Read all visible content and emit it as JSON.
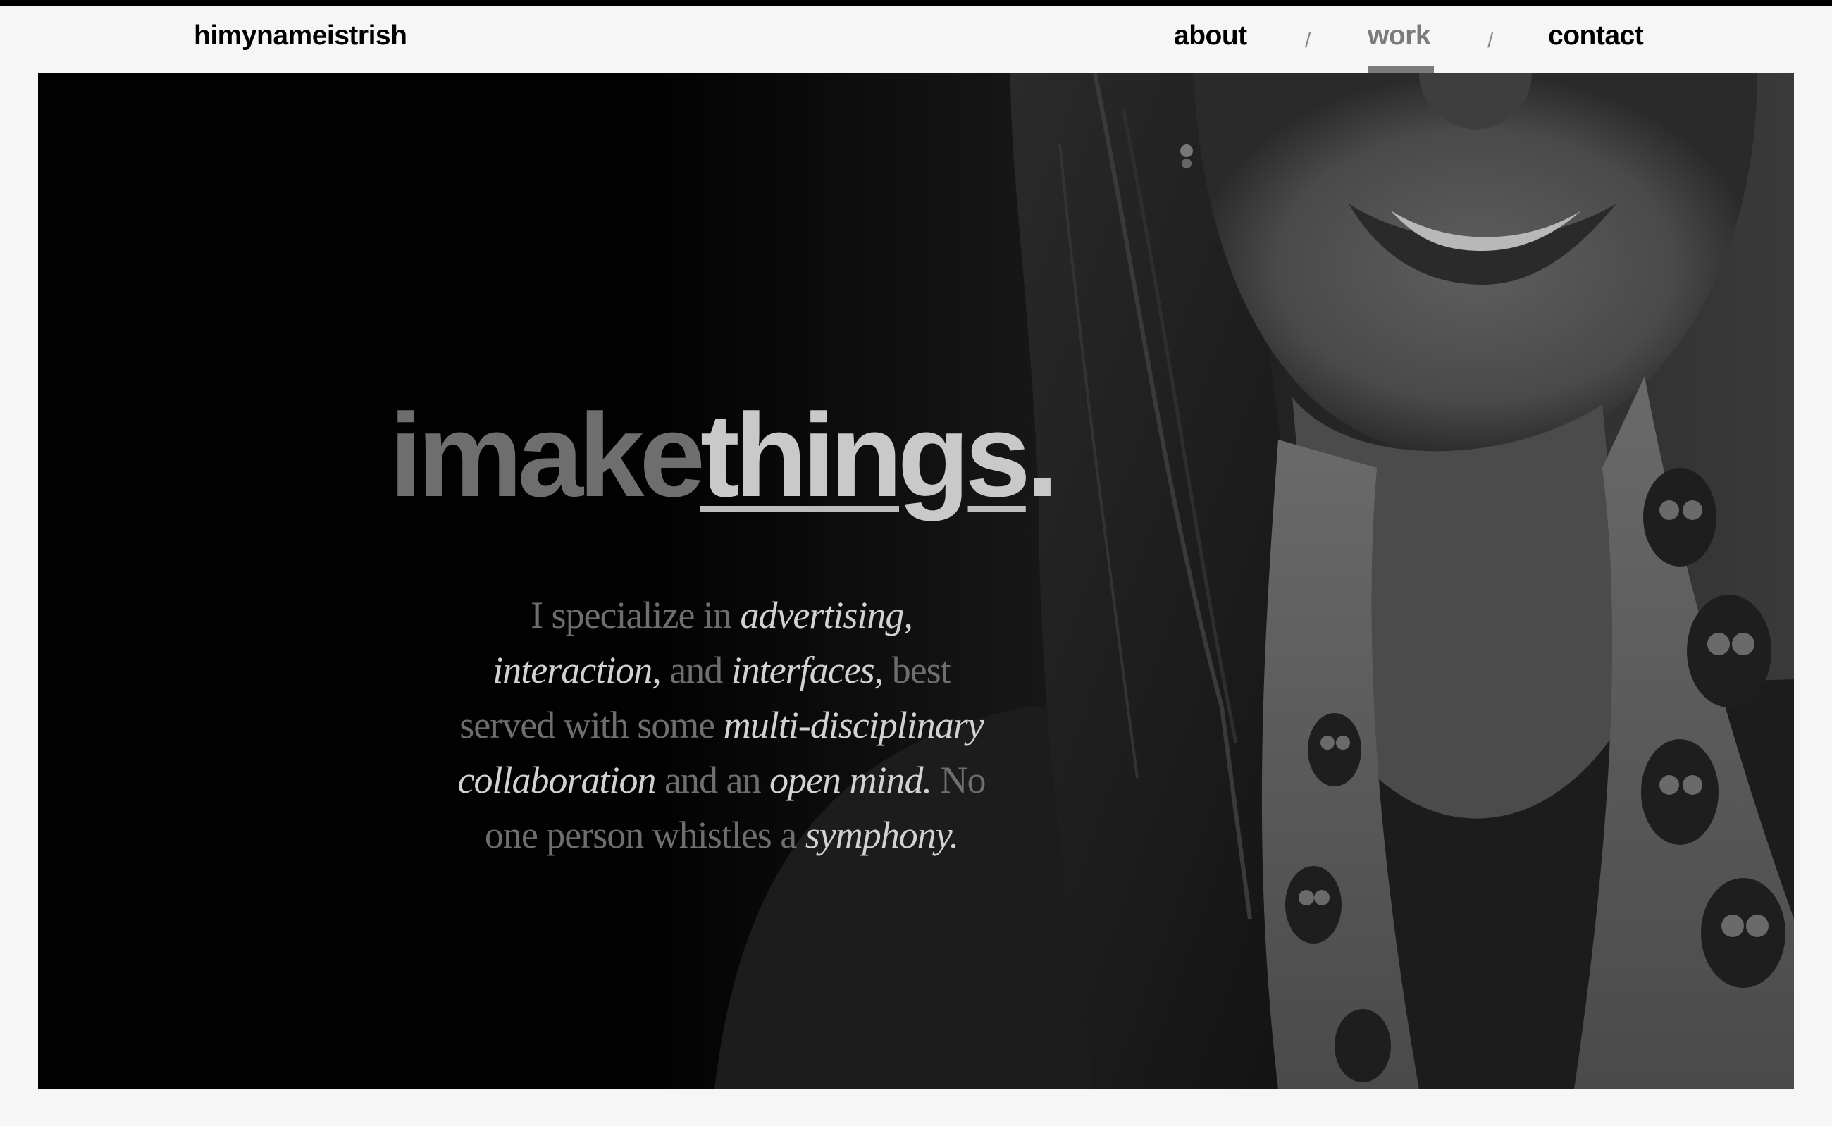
{
  "header": {
    "brand": "himynameistrish",
    "nav": [
      {
        "label": "about",
        "active": false
      },
      {
        "label": "work",
        "active": true
      },
      {
        "label": "contact",
        "active": false
      }
    ],
    "separator": "/"
  },
  "hero": {
    "headline_prefix": "imake",
    "headline_emphasis": "things",
    "headline_suffix": ".",
    "tagline_parts": [
      {
        "text": "I specialize in ",
        "emphasis": false
      },
      {
        "text": "advertising, interaction,",
        "emphasis": true
      },
      {
        "text": " and ",
        "emphasis": false
      },
      {
        "text": "interfaces,",
        "emphasis": true
      },
      {
        "text": " best served with some ",
        "emphasis": false
      },
      {
        "text": "multi-disciplinary collaboration",
        "emphasis": true
      },
      {
        "text": " and an ",
        "emphasis": false
      },
      {
        "text": "open mind.",
        "emphasis": true
      },
      {
        "text": " No one person whistles a ",
        "emphasis": false
      },
      {
        "text": "symphony.",
        "emphasis": true
      }
    ]
  },
  "colors": {
    "page_background": "#f6f6f6",
    "hero_background": "#020202",
    "nav_active": "#7b7b7b",
    "headline_muted": "#6e6e6e",
    "headline_emphasis": "#c9c9c9"
  }
}
